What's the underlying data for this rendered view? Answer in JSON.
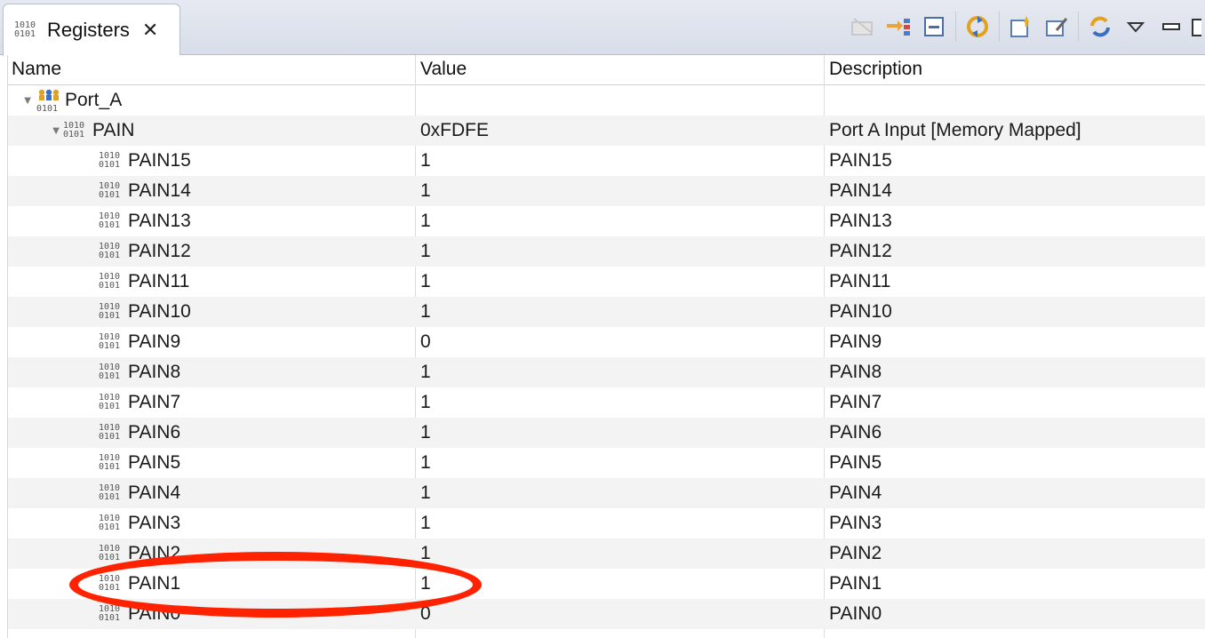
{
  "tab": {
    "title": "Registers",
    "close_icon": "close-icon"
  },
  "toolbar": {
    "icons": [
      "remove-icon",
      "go-to-icon",
      "collapse-all-icon",
      "refresh-icon",
      "new-group-icon",
      "edit-group-icon",
      "sync-icon",
      "view-menu-icon",
      "minimize-icon"
    ]
  },
  "table": {
    "columns": {
      "name": "Name",
      "value": "Value",
      "description": "Description"
    },
    "group": {
      "name": "Port_A",
      "value": "",
      "description": ""
    },
    "register": {
      "name": "PAIN",
      "value": "0xFDFE",
      "description": "Port A Input [Memory Mapped]"
    },
    "fields": [
      {
        "name": "PAIN15",
        "value": "1",
        "description": "PAIN15"
      },
      {
        "name": "PAIN14",
        "value": "1",
        "description": "PAIN14"
      },
      {
        "name": "PAIN13",
        "value": "1",
        "description": "PAIN13"
      },
      {
        "name": "PAIN12",
        "value": "1",
        "description": "PAIN12"
      },
      {
        "name": "PAIN11",
        "value": "1",
        "description": "PAIN11"
      },
      {
        "name": "PAIN10",
        "value": "1",
        "description": "PAIN10"
      },
      {
        "name": "PAIN9",
        "value": "0",
        "description": "PAIN9"
      },
      {
        "name": "PAIN8",
        "value": "1",
        "description": "PAIN8"
      },
      {
        "name": "PAIN7",
        "value": "1",
        "description": "PAIN7"
      },
      {
        "name": "PAIN6",
        "value": "1",
        "description": "PAIN6"
      },
      {
        "name": "PAIN5",
        "value": "1",
        "description": "PAIN5"
      },
      {
        "name": "PAIN4",
        "value": "1",
        "description": "PAIN4"
      },
      {
        "name": "PAIN3",
        "value": "1",
        "description": "PAIN3"
      },
      {
        "name": "PAIN2",
        "value": "1",
        "description": "PAIN2"
      },
      {
        "name": "PAIN1",
        "value": "1",
        "description": "PAIN1"
      },
      {
        "name": "PAIN0",
        "value": "0",
        "description": "PAIN0"
      }
    ]
  },
  "annotation": {
    "color": "#ff2200",
    "target": "PAIN1"
  }
}
